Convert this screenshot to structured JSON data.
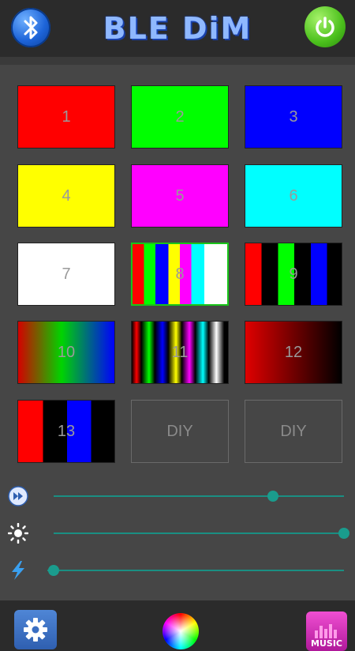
{
  "header": {
    "title": "BLE DiM",
    "bluetooth_icon": "bluetooth-icon",
    "power_icon": "power-icon",
    "colors": {
      "title": "#8fb8ff",
      "power": "#4bc01c",
      "bluetooth": "#1d64d9"
    }
  },
  "tiles": [
    {
      "label": "1",
      "fill": "#ff0000"
    },
    {
      "label": "2",
      "fill": "#00ff00"
    },
    {
      "label": "3",
      "fill": "#0000ff"
    },
    {
      "label": "4",
      "fill": "#ffff00"
    },
    {
      "label": "5",
      "fill": "#ff00ff"
    },
    {
      "label": "6",
      "fill": "#00ffff"
    },
    {
      "label": "7",
      "fill": "#ffffff"
    },
    {
      "label": "8",
      "fill": "stripes-7",
      "selected": true
    },
    {
      "label": "9",
      "fill": "stripes-rgb-black"
    },
    {
      "label": "10",
      "fill": "gradient-red-green-blue"
    },
    {
      "label": "11",
      "fill": "stripes-gradient"
    },
    {
      "label": "12",
      "fill": "gradient-red-black"
    },
    {
      "label": "13",
      "fill": "stripes-red-black-blue-black"
    },
    {
      "label": "DIY",
      "fill": "diy"
    },
    {
      "label": "DIY",
      "fill": "diy"
    }
  ],
  "sliders": [
    {
      "name": "speed",
      "icon": "fast-forward-icon",
      "value": 0.75
    },
    {
      "name": "brightness",
      "icon": "brightness-icon",
      "value": 1.0
    },
    {
      "name": "power",
      "icon": "lightning-icon",
      "value": 0.0
    }
  ],
  "footer": {
    "settings_icon": "gear-icon",
    "color_icon": "color-wheel-icon",
    "music_label": "MUSIC",
    "music_icon": "equalizer-icon"
  }
}
